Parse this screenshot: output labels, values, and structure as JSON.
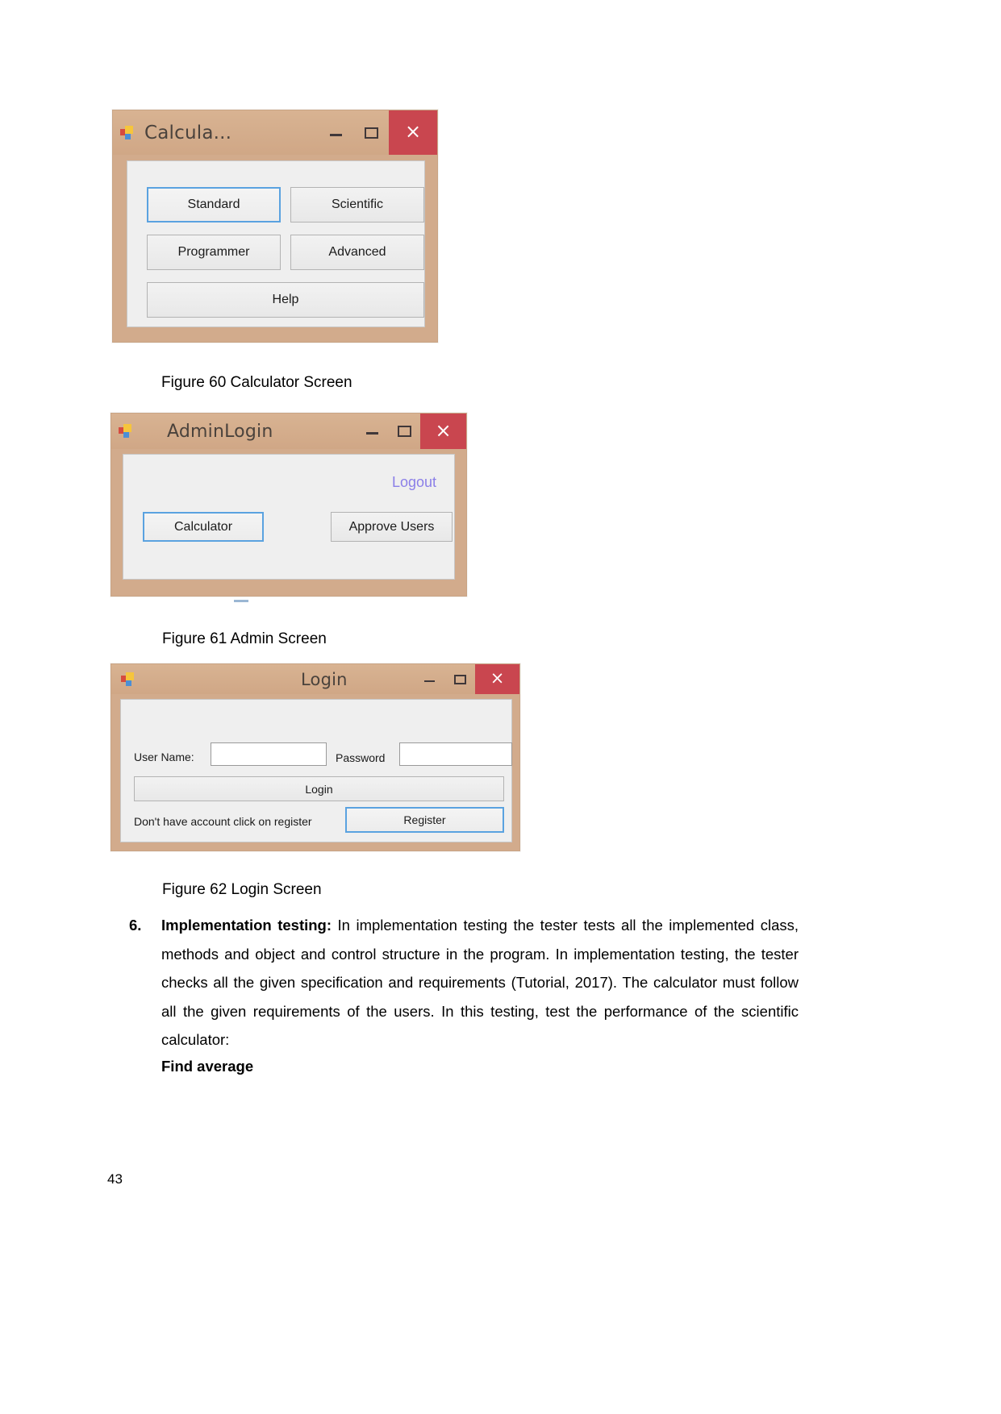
{
  "page": {
    "number": "43",
    "background": "#ffffff"
  },
  "figures": [
    {
      "id": "calculator-window",
      "window_title": "Calcula...",
      "caption": "Figure 60 Calculator Screen",
      "sys_buttons": {
        "minimize": "minimize-icon",
        "maximize": "maximize-icon",
        "close": "×"
      },
      "buttons": [
        {
          "label": "Standard",
          "focused": true
        },
        {
          "label": "Scientific",
          "focused": false
        },
        {
          "label": "Programmer",
          "focused": false
        },
        {
          "label": "Advanced",
          "focused": false
        },
        {
          "label": "Help",
          "focused": false
        }
      ]
    },
    {
      "id": "admin-login-window",
      "window_title": "AdminLogin",
      "caption": "Figure 61 Admin Screen",
      "sys_buttons": {
        "minimize": "minimize-icon",
        "maximize": "maximize-icon",
        "close": "×"
      },
      "link": "Logout",
      "buttons": [
        {
          "label": "Calculator",
          "focused": true
        },
        {
          "label": "Approve Users",
          "focused": false
        }
      ]
    },
    {
      "id": "login-window",
      "window_title": "Login",
      "caption": "Figure 62 Login Screen",
      "sys_buttons": {
        "minimize": "minimize-icon",
        "maximize": "maximize-icon",
        "close": "×"
      },
      "fields": [
        {
          "label": "User Name:",
          "value": "",
          "placeholder": ""
        },
        {
          "label": "Password",
          "value": "",
          "placeholder": ""
        }
      ],
      "buttons": [
        {
          "label": "Login",
          "focused": false
        },
        {
          "label": "Register",
          "focused": true
        }
      ],
      "hint": "Don't have account click on register"
    }
  ],
  "body": {
    "item_number": "6.",
    "lead_bold": "Implementation testing:",
    "paragraph": " In implementation testing the tester tests all the implemented class, methods and object and control structure in the program. In implementation testing, the tester checks all the given specification and requirements (Tutorial, 2017). The calculator must follow all the given requirements of the users. In this testing, test the performance of the scientific calculator:",
    "subheading": "Find average"
  },
  "colors": {
    "title_bar": "#d2ab8c",
    "close_button": "#c9464f",
    "client_area": "#efefef",
    "focus_border": "#5aa2e0",
    "link": "#8b7fe8"
  }
}
